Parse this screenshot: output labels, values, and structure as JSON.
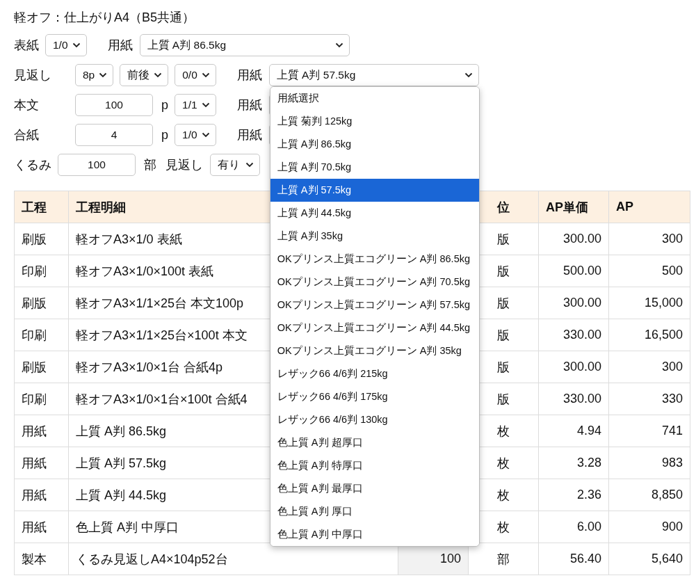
{
  "title": "軽オフ：仕上がりA4（B5共通）",
  "form_rows": [
    {
      "kind": "inline",
      "label": "表紙",
      "controls": [
        {
          "kind": "select",
          "value": "1/0"
        },
        {
          "kind": "label",
          "text": "用紙"
        },
        {
          "kind": "paper",
          "value": "上質 A判 86.5kg"
        }
      ]
    },
    {
      "kind": "column",
      "label": "見返し",
      "controls": [
        {
          "kind": "select",
          "value": "8p"
        },
        {
          "kind": "select",
          "value": "前後"
        },
        {
          "kind": "select",
          "value": "0/0"
        },
        {
          "kind": "label",
          "text": "用紙"
        },
        {
          "kind": "paper",
          "value": "上質 A判 57.5kg",
          "expanded": true,
          "options": [
            {
              "label": "用紙選択",
              "selected": false
            },
            {
              "label": "上質 菊判 125kg",
              "selected": false
            },
            {
              "label": "上質 A判 86.5kg",
              "selected": false
            },
            {
              "label": "上質 A判 70.5kg",
              "selected": false
            },
            {
              "label": "上質 A判 57.5kg",
              "selected": true
            },
            {
              "label": "上質 A判 44.5kg",
              "selected": false
            },
            {
              "label": "上質 A判 35kg",
              "selected": false
            },
            {
              "label": "OKプリンス上質エコグリーン A判 86.5kg",
              "selected": false
            },
            {
              "label": "OKプリンス上質エコグリーン A判 70.5kg",
              "selected": false
            },
            {
              "label": "OKプリンス上質エコグリーン A判 57.5kg",
              "selected": false
            },
            {
              "label": "OKプリンス上質エコグリーン A判 44.5kg",
              "selected": false
            },
            {
              "label": "OKプリンス上質エコグリーン A判 35kg",
              "selected": false
            },
            {
              "label": "レザック66 4/6判 215kg",
              "selected": false
            },
            {
              "label": "レザック66 4/6判 175kg",
              "selected": false
            },
            {
              "label": "レザック66 4/6判 130kg",
              "selected": false
            },
            {
              "label": "色上質 A判 超厚口",
              "selected": false
            },
            {
              "label": "色上質 A判 特厚口",
              "selected": false
            },
            {
              "label": "色上質 A判 最厚口",
              "selected": false
            },
            {
              "label": "色上質 A判 厚口",
              "selected": false
            },
            {
              "label": "色上質 A判 中厚口",
              "selected": false
            }
          ]
        }
      ]
    },
    {
      "kind": "column",
      "label": "本文",
      "controls": [
        {
          "kind": "input",
          "value": "100"
        },
        {
          "kind": "unit",
          "text": "p"
        },
        {
          "kind": "select",
          "value": "1/1"
        },
        {
          "kind": "label",
          "text": "用紙"
        },
        {
          "kind": "paper"
        }
      ]
    },
    {
      "kind": "column",
      "label": "合紙",
      "controls": [
        {
          "kind": "input",
          "value": "4"
        },
        {
          "kind": "unit",
          "text": "p"
        },
        {
          "kind": "select",
          "value": "1/0"
        },
        {
          "kind": "label",
          "text": "用紙"
        },
        {
          "kind": "paper"
        }
      ]
    },
    {
      "kind": "inline",
      "label": "くるみ",
      "controls": [
        {
          "kind": "input",
          "value": "100"
        },
        {
          "kind": "unit",
          "text": "部"
        },
        {
          "kind": "label",
          "text": "見返し"
        },
        {
          "kind": "choice",
          "value": "有り"
        }
      ]
    }
  ],
  "table": {
    "header": {
      "process": "工程",
      "detail": "工程明細",
      "unit": "位",
      "unit_price": "AP単価",
      "amount": "AP"
    },
    "rows": [
      {
        "process": "刷版",
        "detail": "軽オフA3×1/0 表紙",
        "unit": "版",
        "unit_price": "300.00",
        "amount": "300"
      },
      {
        "process": "印刷",
        "detail": "軽オフA3×1/0×100t 表紙",
        "unit": "版",
        "unit_price": "500.00",
        "amount": "500"
      },
      {
        "process": "刷版",
        "detail": "軽オフA3×1/1×25台 本文100p",
        "unit": "版",
        "unit_price": "300.00",
        "amount": "15,000"
      },
      {
        "process": "印刷",
        "detail": "軽オフA3×1/1×25台×100t 本文",
        "unit": "版",
        "unit_price": "330.00",
        "amount": "16,500"
      },
      {
        "process": "刷版",
        "detail": "軽オフA3×1/0×1台 合紙4p",
        "unit": "版",
        "unit_price": "300.00",
        "amount": "300"
      },
      {
        "process": "印刷",
        "detail": "軽オフA3×1/0×1台×100t 合紙4",
        "unit": "版",
        "unit_price": "330.00",
        "amount": "330"
      },
      {
        "process": "用紙",
        "detail": "上質 A判 86.5kg",
        "unit": "枚",
        "unit_price": "4.94",
        "amount": "741"
      },
      {
        "process": "用紙",
        "detail": "上質 A判 57.5kg",
        "unit": "枚",
        "unit_price": "3.28",
        "amount": "983"
      },
      {
        "process": "用紙",
        "detail": "上質 A判 44.5kg",
        "unit": "枚",
        "unit_price": "2.36",
        "amount": "8,850"
      },
      {
        "process": "用紙",
        "detail": "色上質 A判 中厚口",
        "unit": "枚",
        "unit_price": "6.00",
        "amount": "900"
      },
      {
        "process": "製本",
        "detail": "くるみ見返しA4×104p52台",
        "quantity": "100",
        "unit": "部",
        "unit_price": "56.40",
        "amount": "5,640"
      }
    ]
  }
}
